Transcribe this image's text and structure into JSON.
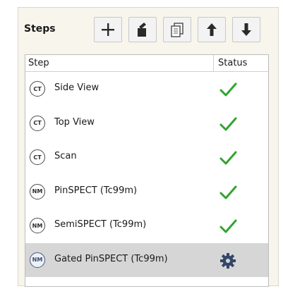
{
  "panel": {
    "title": "Steps"
  },
  "toolbar": {
    "buttons": [
      {
        "name": "add",
        "icon": "plus-icon"
      },
      {
        "name": "remove",
        "icon": "clear-icon"
      },
      {
        "name": "duplicate",
        "icon": "copy-icon"
      },
      {
        "name": "move-up",
        "icon": "arrow-up-icon"
      },
      {
        "name": "move-down",
        "icon": "arrow-down-icon"
      }
    ]
  },
  "table": {
    "headers": {
      "step": "Step",
      "status": "Status"
    },
    "rows": [
      {
        "type": "CT",
        "label": "Side View",
        "status": "done"
      },
      {
        "type": "CT",
        "label": "Top View",
        "status": "done"
      },
      {
        "type": "CT",
        "label": "Scan",
        "status": "done"
      },
      {
        "type": "NM",
        "label": "PinSPECT (Tc99m)",
        "status": "done"
      },
      {
        "type": "NM",
        "label": "SemiSPECT (Tc99m)",
        "status": "done"
      },
      {
        "type": "NM",
        "label": "Gated PinSPECT (Tc99m)",
        "status": "in-progress",
        "selected": true
      }
    ]
  },
  "colors": {
    "check": "#2fa52f",
    "gear": "#33476a",
    "selected_row": "#d6d6d6",
    "panel_bg": "#f7f5ec"
  }
}
